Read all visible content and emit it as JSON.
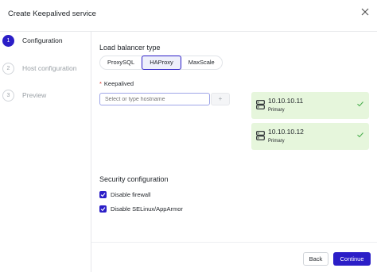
{
  "dialog": {
    "title": "Create Keepalived service"
  },
  "steps": [
    {
      "number": "1",
      "label": "Configuration",
      "state": "active"
    },
    {
      "number": "2",
      "label": "Host configuration",
      "state": "inactive"
    },
    {
      "number": "3",
      "label": "Preview",
      "state": "inactive"
    }
  ],
  "load_balancer": {
    "title": "Load balancer type",
    "options": [
      "ProxySQL",
      "HAProxy",
      "MaxScale"
    ],
    "selected": "HAProxy"
  },
  "keepalived": {
    "label": "Keepalived",
    "placeholder": "Select or type hostname",
    "add_label": "+"
  },
  "nodes": [
    {
      "ip": "10.10.10.11",
      "role": "Primary"
    },
    {
      "ip": "10.10.10.12",
      "role": "Primary"
    }
  ],
  "security": {
    "title": "Security configuration",
    "options": [
      {
        "label": "Disable firewall",
        "checked": true
      },
      {
        "label": "Disable SELinux/AppArmor",
        "checked": true
      }
    ]
  },
  "footer": {
    "back_label": "Back",
    "continue_label": "Continue"
  },
  "colors": {
    "accent": "#2b1ec7",
    "node_bg": "#e6f6dc",
    "check": "#4caf50"
  }
}
